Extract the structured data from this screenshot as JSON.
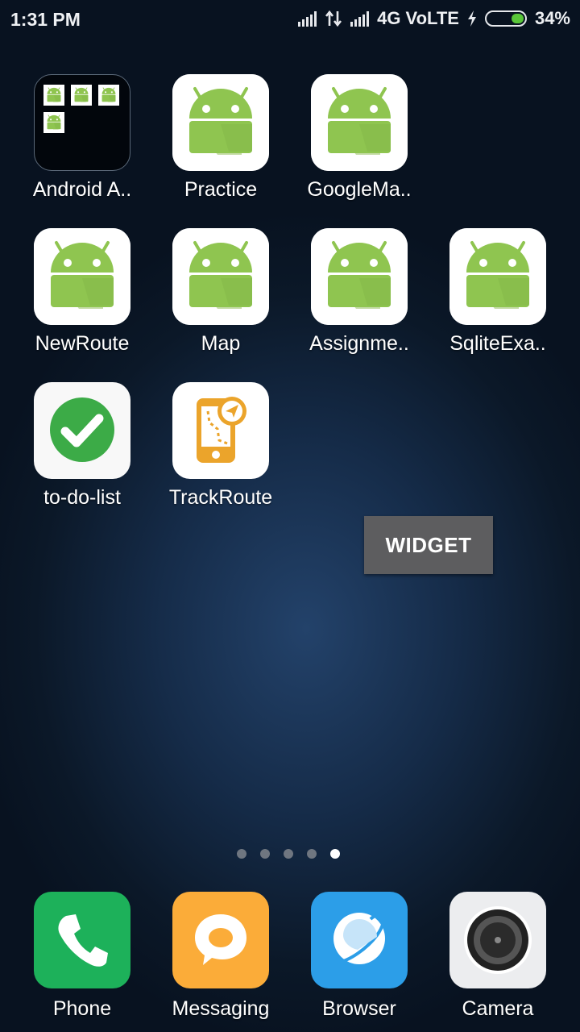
{
  "status_bar": {
    "time": "1:31 PM",
    "network": "4G VoLTE",
    "battery_percent": "34%",
    "battery_level": 0.34,
    "colors": {
      "battery_fill": "#59c639"
    }
  },
  "apps": [
    {
      "label": "Android A..",
      "icon": "folder-icon"
    },
    {
      "label": "Practice",
      "icon": "android-icon"
    },
    {
      "label": "GoogleMa..",
      "icon": "android-icon"
    },
    {
      "label": "NewRoute",
      "icon": "android-icon"
    },
    {
      "label": "Map",
      "icon": "android-icon"
    },
    {
      "label": "Assignme..",
      "icon": "android-icon"
    },
    {
      "label": "SqliteExa..",
      "icon": "android-icon"
    },
    {
      "label": "to-do-list",
      "icon": "checkmark-icon"
    },
    {
      "label": "TrackRoute",
      "icon": "track-route-icon"
    }
  ],
  "widget_button": {
    "label": "WIDGET"
  },
  "pager": {
    "page_count": 5,
    "active_page": 5
  },
  "dock": [
    {
      "label": "Phone",
      "icon": "phone-icon",
      "color": "#1db15a"
    },
    {
      "label": "Messaging",
      "icon": "message-icon",
      "color": "#fbac39"
    },
    {
      "label": "Browser",
      "icon": "browser-icon",
      "color": "#2c9ee8"
    },
    {
      "label": "Camera",
      "icon": "camera-icon",
      "color": "#ecedef"
    }
  ]
}
